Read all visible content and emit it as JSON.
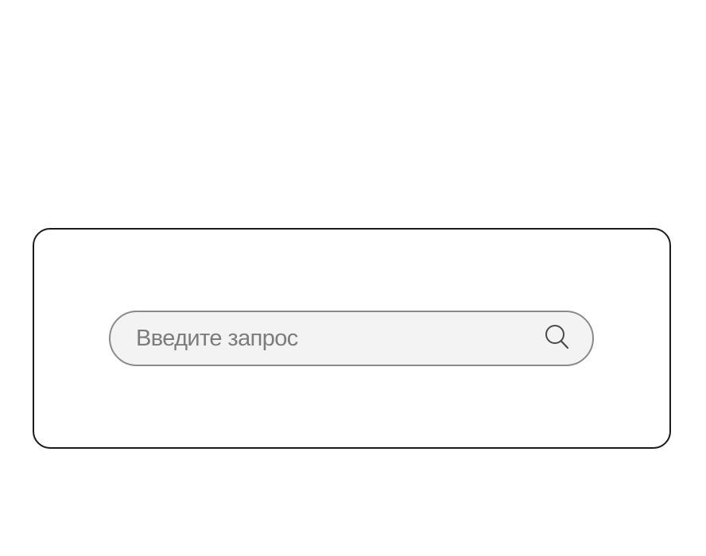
{
  "search": {
    "value": "",
    "placeholder": "Введите запрос",
    "icon": "search-icon"
  },
  "colors": {
    "card_border": "#1b1b1b",
    "search_border": "#8a8a8a",
    "search_background": "#f3f3f3",
    "placeholder_text": "#7c7c7c",
    "icon_stroke": "#4a4a4a"
  }
}
